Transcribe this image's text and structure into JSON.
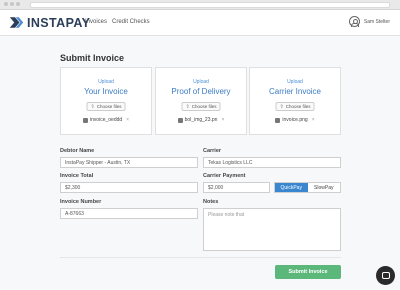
{
  "brand": {
    "name": "INSTAPAY",
    "accent": "#3b7cc4",
    "logo_color": "#2c3e5a"
  },
  "nav": {
    "links": [
      "Invoices",
      "Credit Checks"
    ],
    "user_name": "Sam Stelter"
  },
  "page": {
    "title": "Submit Invoice"
  },
  "uploads": [
    {
      "label": "Upload",
      "title": "Your Invoice",
      "button": "Choose files",
      "file": "invoice_oeddd"
    },
    {
      "label": "Upload",
      "title": "Proof of Delivery",
      "button": "Choose files",
      "file": "bol_img_23.pn"
    },
    {
      "label": "Upload",
      "title": "Carrier Invoice",
      "button": "Choose files",
      "file": "invoice.png"
    }
  ],
  "form": {
    "debtor_name": {
      "label": "Debtor Name",
      "value": "InstaPay Shipper - Austin, TX"
    },
    "carrier": {
      "label": "Carrier",
      "value": "Tekas Logistics LLC"
    },
    "invoice_total": {
      "label": "Invoice Total",
      "value": "$2,300"
    },
    "carrier_payment": {
      "label": "Carrier Payment",
      "value": "$2,000",
      "options": [
        "QuickPay",
        "SlowPay"
      ],
      "selected": "QuickPay"
    },
    "invoice_number": {
      "label": "Invoice Number",
      "value": "A-87663"
    },
    "notes": {
      "label": "Notes",
      "placeholder": "Please note that"
    }
  },
  "actions": {
    "submit_label": "Submit Invoice",
    "submit_color": "#5cb87a"
  }
}
